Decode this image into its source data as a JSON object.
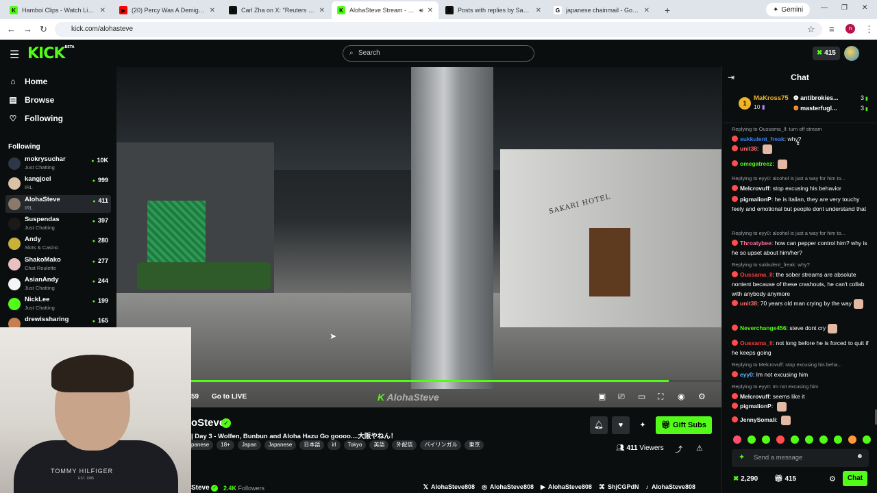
{
  "browser": {
    "tabs": [
      {
        "title": "Hamboi Clips - Watch Live on Kick",
        "favicon_color": "#53fc18",
        "favicon_text": "K",
        "active": false
      },
      {
        "title": "(20) Percy Was A Demigod Wh...",
        "favicon_color": "#ff0000",
        "favicon_text": "▶",
        "active": false
      },
      {
        "title": "Carl Zha on X: \"Reuters Japan d...",
        "favicon_color": "#111111",
        "favicon_text": "X",
        "active": false
      },
      {
        "title": "AlohaSteve Stream - Watch",
        "favicon_color": "#53fc18",
        "favicon_text": "K",
        "active": true
      },
      {
        "title": "Posts with replies by Sam Pepp...",
        "favicon_color": "#111111",
        "favicon_text": "X",
        "active": false
      },
      {
        "title": "japanese chainmail - Google Se...",
        "favicon_color": "#ffffff",
        "favicon_text": "G",
        "active": false
      }
    ],
    "new_tab": "+",
    "gemini": "Gemini",
    "url": "kick.com/alohasteve",
    "profile_initial": "n"
  },
  "header": {
    "logo": "KICK",
    "logo_beta": "BETA",
    "search_placeholder": "Search",
    "kicks_balance": "415"
  },
  "sidebar": {
    "nav": [
      {
        "label": "Home",
        "icon": "home-icon"
      },
      {
        "label": "Browse",
        "icon": "browse-icon"
      },
      {
        "label": "Following",
        "icon": "heart-icon"
      }
    ],
    "following_title": "Following",
    "channels": [
      {
        "name": "mokrysuchar",
        "category": "Just Chatting",
        "viewers": "10K",
        "avatar_color": "#2d3748"
      },
      {
        "name": "kangjoel",
        "category": "IRL",
        "viewers": "999",
        "avatar_color": "#d9c2a6"
      },
      {
        "name": "AlohaSteve",
        "category": "IRL",
        "viewers": "411",
        "avatar_color": "#8a7a6a",
        "selected": true
      },
      {
        "name": "Suspendas",
        "category": "Just Chatting",
        "viewers": "397",
        "avatar_color": "#1a1a1a"
      },
      {
        "name": "Andy",
        "category": "Slots & Casino",
        "viewers": "280",
        "avatar_color": "#c9b037"
      },
      {
        "name": "ShakoMako",
        "category": "Chat Roulette",
        "viewers": "277",
        "avatar_color": "#e8c1c1"
      },
      {
        "name": "AsianAndy",
        "category": "Just Chatting",
        "viewers": "244",
        "avatar_color": "#f5f5f5"
      },
      {
        "name": "NickLee",
        "category": "Just Chatting",
        "viewers": "199",
        "avatar_color": "#53fc18"
      },
      {
        "name": "drewissharing",
        "category": "",
        "viewers": "165",
        "avatar_color": "#c77f4f"
      }
    ]
  },
  "player": {
    "hotel_sign": "SAKARI HOTEL",
    "progress": 0.9,
    "time_elapsed": "59",
    "go_live": "Go to LIVE",
    "watermark": "AlohaSteve",
    "control_icons": [
      "theater-mode-icon",
      "clip-icon",
      "mini-player-icon",
      "fullscreen-icon",
      "playback-speed-icon",
      "settings-icon"
    ]
  },
  "webcam": {
    "shirt_brand": "TOMMY HILFIGER",
    "shirt_est": "EST. 1985"
  },
  "stream_info": {
    "streamer_name": "oSteve",
    "title": "| Day 3  - Wolfen, Bunbun and Aloha Hazu Go goooo....大阪やねん！",
    "tags": [
      "panese",
      "18+",
      "Japan",
      "Japanese",
      "日本語",
      "irl",
      "Tokyo",
      "英語",
      "外配信",
      "バイリンガル",
      "東京"
    ],
    "gift_subs": "Gift Subs",
    "viewers_count": "411",
    "viewers_label": "Viewers",
    "name_short": "Steve",
    "followers_count": "2.4K",
    "followers_label": "Followers",
    "socials": [
      {
        "icon": "x-icon",
        "glyph": "𝕏",
        "handle": "AlohaSteve808"
      },
      {
        "icon": "instagram-icon",
        "glyph": "◎",
        "handle": "AlohaSteve808"
      },
      {
        "icon": "youtube-icon",
        "glyph": "▶",
        "handle": "AlohaSteve808"
      },
      {
        "icon": "discord-icon",
        "glyph": "⌘",
        "handle": "ShjCGPdN"
      },
      {
        "icon": "tiktok-icon",
        "glyph": "♪",
        "handle": "AlohaSteve808"
      }
    ]
  },
  "chat": {
    "title": "Chat",
    "leaderboard": {
      "first_rank": "1",
      "first_name": "MaKross75",
      "first_count": "10",
      "others": [
        {
          "name": "antibrokies...",
          "count": "3"
        },
        {
          "name": "masterfugl...",
          "count": "3"
        }
      ]
    },
    "messages": [
      {
        "reply": "Replying to Oussama_ll: turn off stream",
        "user": "sukkulent_freak",
        "color": "#3b82f6",
        "text": "why?",
        "emote": false
      },
      {
        "reply": "",
        "user": "unit38",
        "color": "#ff6b6b",
        "text": "",
        "emote": true
      },
      {
        "reply": "",
        "user": "omegatreez",
        "color": "#53fc18",
        "text": "",
        "emote": true
      },
      {
        "reply": "Replying to eyy0: alcohol is just a way for him to...",
        "user": "Melcrovuff",
        "color": "#f5f5f5",
        "text": "stop excusing his behavior",
        "emote": false
      },
      {
        "reply": "",
        "user": "pigmalionP",
        "color": "#f5f5f5",
        "text": "he is italian, they are very touchy feely and emotional but people dont understand that",
        "emote": false
      },
      {
        "reply": "Replying to eyy0: alcohol is just a way for him to...",
        "user": "Throatybee",
        "color": "#ff6b9a",
        "text": "how can pepper control him? why is he so upset about him/her?",
        "emote": false
      },
      {
        "reply": "Replying to sukkulent_freak: why?",
        "user": "Oussama_ll",
        "color": "#ff3b3b",
        "text": "the sober streams are absolute nontent because of these crashouts, he can't collab with anybody anymore",
        "emote": false
      },
      {
        "reply": "",
        "user": "unit38",
        "color": "#ff6b6b",
        "text": "70 years old man crying by the way",
        "emote": true
      },
      {
        "reply": "",
        "user": "Neverchange456",
        "color": "#53fc18",
        "text": "steve dont cry",
        "emote": true
      },
      {
        "reply": "",
        "user": "Oussama_ll",
        "color": "#ff3b3b",
        "text": "not long before he is forced to quit if he keeps going",
        "emote": false
      },
      {
        "reply": "Replying to Melcrovuff: stop excusing his beha...",
        "user": "eyy0",
        "color": "#5fb3ff",
        "text": "Im not excusing him",
        "emote": false
      },
      {
        "reply": "Replying to eyy0: Im not excusing him",
        "user": "Melcrovuff",
        "color": "#f5f5f5",
        "text": "seems like it",
        "emote": false
      },
      {
        "reply": "",
        "user": "pigmalionP",
        "color": "#f5f5f5",
        "text": "",
        "emote": true
      },
      {
        "reply": "",
        "user": "JennySomali",
        "color": "#f5f5f5",
        "text": "",
        "emote": true
      }
    ],
    "input_placeholder": "Send a message",
    "kicks": "2,290",
    "gift_count": "415",
    "send": "Chat"
  }
}
